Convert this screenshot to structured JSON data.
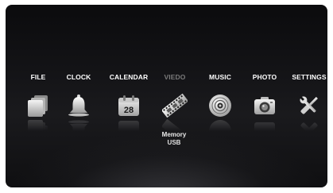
{
  "menu": {
    "items": [
      {
        "label": "FILE",
        "icon": "file-stack-icon"
      },
      {
        "label": "CLOCK",
        "icon": "bell-icon"
      },
      {
        "label": "CALENDAR",
        "icon": "calendar-icon",
        "calendar_day": "28"
      },
      {
        "label": "VIEDO",
        "icon": "film-strip-icon",
        "dimmed": true
      },
      {
        "label": "MUSIC",
        "icon": "disc-icon"
      },
      {
        "label": "PHOTO",
        "icon": "camera-icon"
      },
      {
        "label": "SETTINGS",
        "icon": "tools-icon"
      }
    ]
  },
  "submenu": {
    "items": [
      {
        "label": "Memory"
      },
      {
        "label": "USB"
      }
    ]
  },
  "colors": {
    "background": "#141416",
    "label": "#ffffff",
    "label_dim": "#7a7a7a"
  }
}
